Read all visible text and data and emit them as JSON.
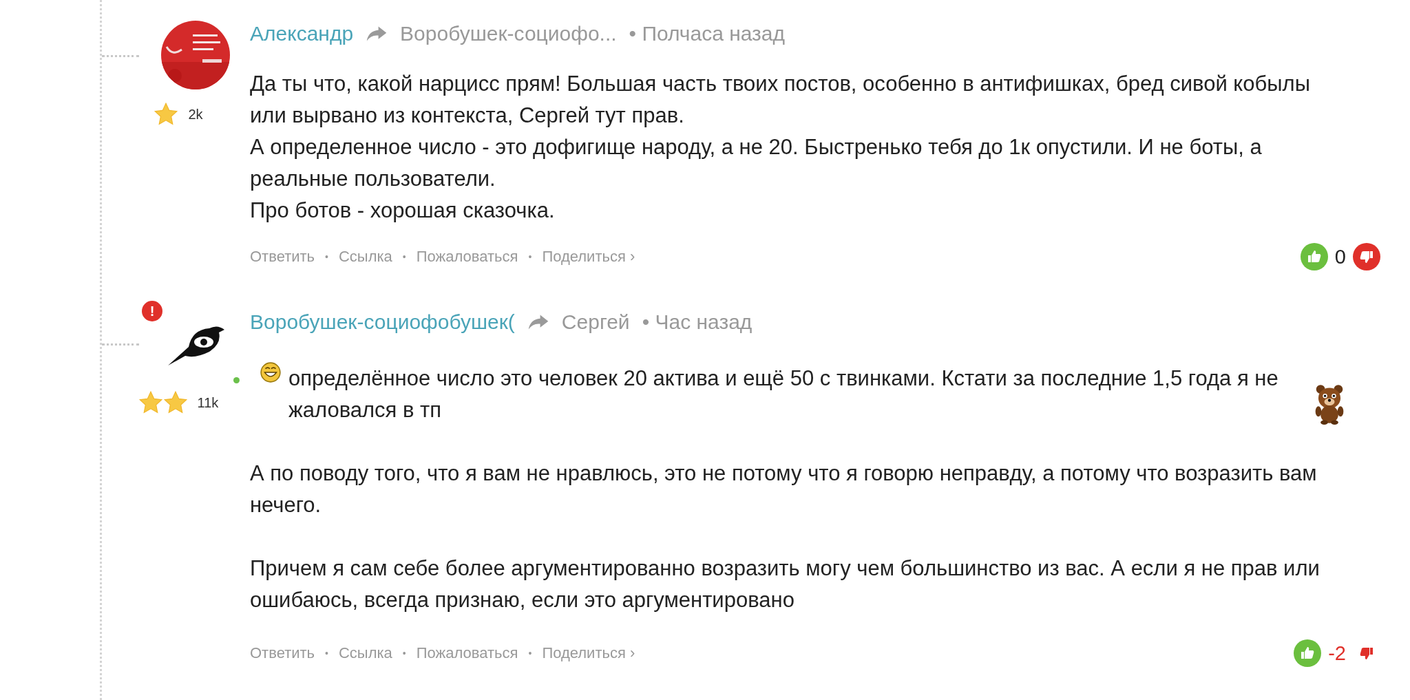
{
  "comments": [
    {
      "author": "Александр",
      "reply_to": "Воробушек-социофо...",
      "time": "• Полчаса назад",
      "avatar": {
        "kind": "picture"
      },
      "rank": [
        {
          "kind": "star"
        }
      ],
      "rating": "2k",
      "compact": true,
      "paragraphs": [
        [
          {
            "kind": "text",
            "text": "Да ты что, какой нарцисс прям! Большая часть твоих постов, особенно в антифишках, бред сивой кобылы или вырвано из контекста, Сергей тут прав."
          }
        ],
        [
          {
            "kind": "text",
            "text": "А определенное число - это дофигище народу, а не 20. Быстренько тебя до 1к опустили. И не боты, а реальные пользователи."
          }
        ],
        [
          {
            "kind": "text",
            "text": "Про ботов - хорошая сказочка."
          }
        ]
      ],
      "actions": [
        "Ответить",
        "Ссылка",
        "Пожаловаться",
        "Поделиться ›"
      ],
      "separator": "•",
      "score": "0",
      "score_negative": false,
      "downvoted": false
    },
    {
      "author": "Воробушек-социофобушек(",
      "reply_to": "Сергей",
      "time": "• Час назад",
      "avatar": {
        "kind": "bird"
      },
      "alert_badge": "!",
      "online": true,
      "rank": [
        {
          "kind": "star"
        },
        {
          "kind": "star"
        }
      ],
      "rating": "11k",
      "compact": false,
      "paragraphs": [
        [
          {
            "kind": "grin"
          },
          {
            "kind": "text",
            "text": "определённое число это человек 20 актива и ещё 50 с твинками. Кстати за последние 1,5 года я не жаловался в тп"
          },
          {
            "kind": "bear"
          }
        ],
        [
          {
            "kind": "text",
            "text": "А по поводу того, что я вам не нравлюсь, это не потому что я говорю неправду, а потому что возразить вам нечего."
          }
        ],
        [
          {
            "kind": "text",
            "text": "Причем я сам себе более аргументированно возразить могу чем большинство из вас. А если я не прав или ошибаюсь, всегда признаю, если это аргументировано"
          }
        ]
      ],
      "actions": [
        "Ответить",
        "Ссылка",
        "Пожаловаться",
        "Поделиться ›"
      ],
      "separator": "•",
      "score": "-2",
      "score_negative": true,
      "downvoted": true
    }
  ]
}
